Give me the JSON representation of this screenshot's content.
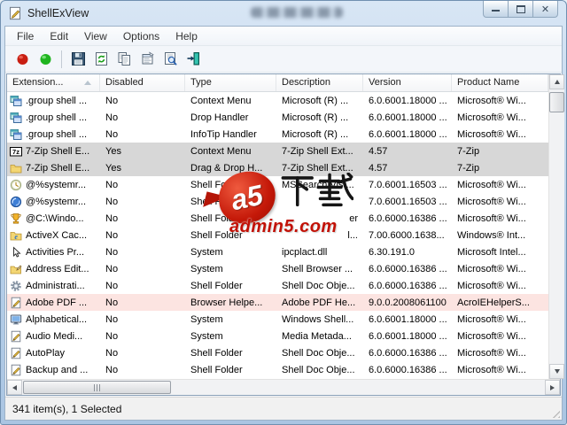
{
  "window": {
    "title": "ShellExView"
  },
  "menu": {
    "items": [
      "File",
      "Edit",
      "View",
      "Options",
      "Help"
    ]
  },
  "toolbar": {
    "buttons": [
      {
        "name": "disable-selected-button",
        "icon": "red-circle-icon",
        "sep_after": false
      },
      {
        "name": "enable-selected-button",
        "icon": "green-circle-icon",
        "sep_after": true
      },
      {
        "name": "save-button",
        "icon": "floppy-icon",
        "sep_after": false
      },
      {
        "name": "refresh-button",
        "icon": "refresh-icon",
        "sep_after": false
      },
      {
        "name": "copy-button",
        "icon": "copy-icon",
        "sep_after": false
      },
      {
        "name": "properties-button",
        "icon": "properties-icon",
        "sep_after": false
      },
      {
        "name": "find-button",
        "icon": "find-icon",
        "sep_after": false
      },
      {
        "name": "exit-button",
        "icon": "exit-icon",
        "sep_after": false
      }
    ]
  },
  "list": {
    "columns": [
      {
        "label": "Extension...",
        "sorted": "asc"
      },
      {
        "label": "Disabled"
      },
      {
        "label": "Type"
      },
      {
        "label": "Description"
      },
      {
        "label": "Version"
      },
      {
        "label": "Product Name"
      }
    ],
    "rows": [
      {
        "icon": "group-windows-icon",
        "extension": ".group shell ...",
        "disabled": "No",
        "type": "Context Menu",
        "description": "Microsoft (R) ...",
        "version": "6.0.6001.18000 ...",
        "product": "Microsoft® Wi...",
        "state": "normal"
      },
      {
        "icon": "group-windows-icon",
        "extension": ".group shell ...",
        "disabled": "No",
        "type": "Drop Handler",
        "description": "Microsoft (R) ...",
        "version": "6.0.6001.18000 ...",
        "product": "Microsoft® Wi...",
        "state": "normal"
      },
      {
        "icon": "group-windows-icon",
        "extension": ".group shell ...",
        "disabled": "No",
        "type": "InfoTip Handler",
        "description": "Microsoft (R) ...",
        "version": "6.0.6001.18000 ...",
        "product": "Microsoft® Wi...",
        "state": "normal"
      },
      {
        "icon": "7zip-icon",
        "extension": "7-Zip Shell E...",
        "disabled": "Yes",
        "type": "Context Menu",
        "description": "7-Zip Shell Ext...",
        "version": "4.57",
        "product": "7-Zip",
        "state": "disabled"
      },
      {
        "icon": "folder-icon",
        "extension": "7-Zip Shell E...",
        "disabled": "Yes",
        "type": "Drag & Drop H...",
        "description": "7-Zip Shell Ext...",
        "version": "4.57",
        "product": "7-Zip",
        "state": "disabled"
      },
      {
        "icon": "clock-icon",
        "extension": "@%systemr...",
        "disabled": "No",
        "type": "Shell Folder",
        "description": "MSSearch Vist...",
        "version": "7.0.6001.16503 ...",
        "product": "Microsoft® Wi...",
        "state": "normal"
      },
      {
        "icon": "globe-icon",
        "extension": "@%systemr...",
        "disabled": "No",
        "type": "Shell Folder",
        "description": "",
        "version": "7.0.6001.16503 ...",
        "product": "Microsoft® Wi...",
        "state": "normal"
      },
      {
        "icon": "trophy-icon",
        "extension": "@C:\\Windo...",
        "disabled": "No",
        "type": "Shell Folder",
        "description": "er",
        "frag": true,
        "version": "6.0.6000.16386 ...",
        "product": "Microsoft® Wi...",
        "state": "normal"
      },
      {
        "icon": "ie-folder-icon",
        "extension": "ActiveX Cac...",
        "disabled": "No",
        "type": "Shell Folder",
        "description": "l...",
        "frag": true,
        "version": "7.00.6000.1638...",
        "product": "Windows® Int...",
        "state": "normal"
      },
      {
        "icon": "cursor-icon",
        "extension": "Activities Pr...",
        "disabled": "No",
        "type": "System",
        "description": "ipcplact.dll",
        "version": "6.30.191.0",
        "product": "Microsoft Intel...",
        "state": "normal"
      },
      {
        "icon": "folder-edit-icon",
        "extension": "Address Edit...",
        "disabled": "No",
        "type": "System",
        "description": "Shell Browser ...",
        "version": "6.0.6000.16386 ...",
        "product": "Microsoft® Wi...",
        "state": "normal"
      },
      {
        "icon": "gear-icon",
        "extension": "Administrati...",
        "disabled": "No",
        "type": "Shell Folder",
        "description": "Shell Doc Obje...",
        "version": "6.0.6000.16386 ...",
        "product": "Microsoft® Wi...",
        "state": "normal"
      },
      {
        "icon": "doc-pen-icon",
        "extension": "Adobe PDF ...",
        "disabled": "No",
        "type": "Browser Helpe...",
        "description": "Adobe PDF He...",
        "version": "9.0.0.2008061100",
        "product": "AcroIEHelperS...",
        "state": "alert"
      },
      {
        "icon": "monitor-icon",
        "extension": "Alphabetical...",
        "disabled": "No",
        "type": "System",
        "description": "Windows Shell...",
        "version": "6.0.6001.18000 ...",
        "product": "Microsoft® Wi...",
        "state": "normal"
      },
      {
        "icon": "doc-pen-icon",
        "extension": "Audio Medi...",
        "disabled": "No",
        "type": "System",
        "description": "Media Metada...",
        "version": "6.0.6001.18000 ...",
        "product": "Microsoft® Wi...",
        "state": "normal"
      },
      {
        "icon": "doc-pen-icon",
        "extension": "AutoPlay",
        "disabled": "No",
        "type": "Shell Folder",
        "description": "Shell Doc Obje...",
        "version": "6.0.6000.16386 ...",
        "product": "Microsoft® Wi...",
        "state": "normal"
      },
      {
        "icon": "doc-pen-icon",
        "extension": "Backup and ...",
        "disabled": "No",
        "type": "Shell Folder",
        "description": "Shell Doc Obje...",
        "version": "6.0.6000.16386 ...",
        "product": "Microsoft® Wi...",
        "state": "normal"
      }
    ]
  },
  "watermark": {
    "logo": "a5",
    "cn": "下载",
    "site": "admin5.com"
  },
  "statusbar": {
    "text": "341 item(s), 1 Selected"
  },
  "colors": {
    "disabled_row_bg": "#d7d7d7",
    "alert_row_bg": "#fce4e1",
    "frame_blue": "#b6cfe9",
    "watermark_red": "#c41808"
  }
}
